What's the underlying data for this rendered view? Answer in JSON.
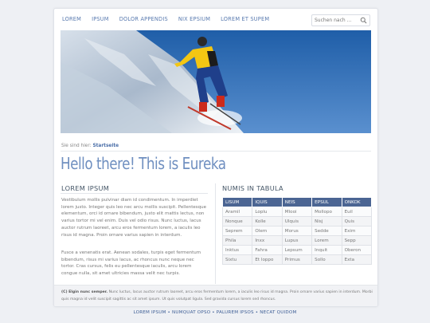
{
  "nav": {
    "items": [
      "LOREM",
      "IPSUM",
      "DOLOR APPENDIS",
      "NIX EPSIUM",
      "LOREM ET SUPEM"
    ],
    "search_placeholder": "Suchen nach ..."
  },
  "breadcrumb": {
    "prefix": "Sie sind hier:",
    "link": "Startseite"
  },
  "headline": "Hello there! This is Eureka",
  "left": {
    "heading": "LOREM IPSUM",
    "paragraph1": "Vestibulum mollis pulvinar diam id condimentum. In imperdiet lorem justo. Integer quis leo nec arcu mollis suscipit. Pellentesque elementum, orci id ornare bibendum, justo elit mattis lectus, non varius tortor mi vel enim. Duis vel odio risus. Nunc luctus, lacus auctor rutrum laoreet, arcu eros fermentum lorem, a iaculis leo risus id magna. Proin ornare varius sapien in interdum.",
    "paragraph2": "Fusce a venenatis erat. Aenean sodales, turpis eget fermentum bibendum, risus mi varius lacus, ac rhoncus nunc neque nec tortor. Cras cursus, felis eu pellentesque iaculis, arcu lorem congue nulla, sit amet ultricies massa velit nec turpis."
  },
  "right": {
    "heading": "NUMIS IN TABULA",
    "columns": [
      "LISUM",
      "IQUIS",
      "NEIS",
      "EPSUL",
      "ONKOK"
    ],
    "rows": [
      [
        "Aramil",
        "Loplu",
        "Mlooi",
        "Mollopo",
        "Euil"
      ],
      [
        "Nonque",
        "Kolle",
        "Ulquis",
        "Nisj",
        "Quis"
      ],
      [
        "Seprem",
        "Olem",
        "Morus",
        "Sedde",
        "Exim"
      ],
      [
        "Phila",
        "Inxx",
        "Lupus",
        "Lorem",
        "Sepp"
      ],
      [
        "Inktus",
        "Fahra",
        "Lepsum",
        "Inquit",
        "Oberon"
      ],
      [
        "Sixtu",
        "Et loppo",
        "Primus",
        "Sollo",
        "Exta"
      ]
    ]
  },
  "footer": {
    "bold": "(C) Elgin nunc semper.",
    "text": "Nunc luctus, lacus auctor rutrum laoreet, arcu eros fermentum lorem, a iaculis leo risus id magna. Proin ornare varius sapien in interdum. Morbi quis magna id velit suscipit sagittis ac sit amet ipsum. Ut quis volutpat ligula. Sed gravida cursus lorem sed rhoncus."
  },
  "bottom_links": [
    "LOREM IPSUM",
    "NUMQUAT OPSO",
    "PALUREM IPSOS",
    "NECAT QUIDOM"
  ],
  "colors": {
    "accent": "#4b6593",
    "headline": "#6f8fc0",
    "link": "#5a7bb0"
  },
  "icons": {
    "search": "search-icon"
  }
}
